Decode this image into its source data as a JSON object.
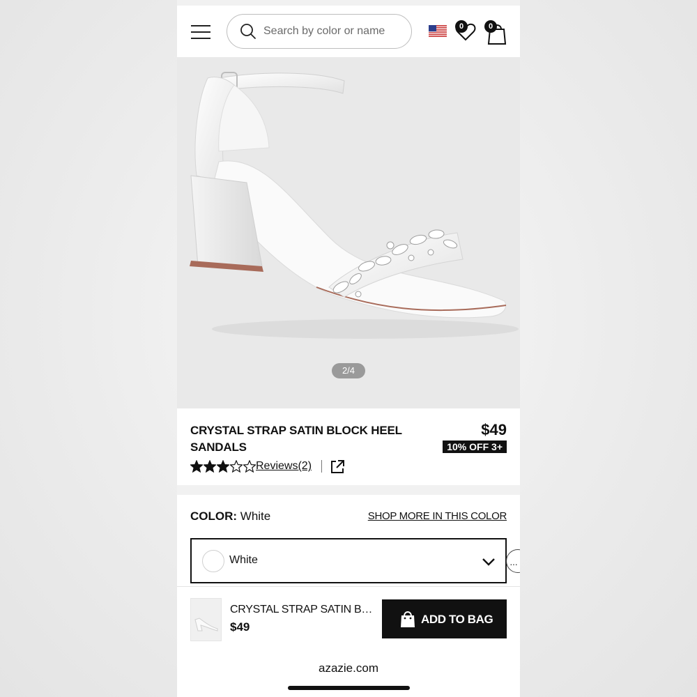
{
  "header": {
    "search_placeholder": "Search by color or name",
    "wishlist_count": "0",
    "bag_count": "0"
  },
  "gallery": {
    "counter": "2/4"
  },
  "product": {
    "title": "CRYSTAL STRAP SATIN BLOCK HEEL SANDALS",
    "price": "$49",
    "discount": "10% OFF 3+",
    "rating": 3,
    "rating_max": 5,
    "reviews_label": "Reviews(2)"
  },
  "color": {
    "label": "COLOR:",
    "value": "White",
    "shop_more": "SHOP MORE IN THIS COLOR",
    "selected": "White"
  },
  "sticky": {
    "name": "CRYSTAL STRAP SATIN BLOCK HEEL SANDALS",
    "price": "$49",
    "add_label": "ADD TO BAG"
  },
  "browser": {
    "url": "azazie.com"
  },
  "icons": [
    "menu-icon",
    "search-icon",
    "us-flag-icon",
    "heart-icon",
    "shopping-bag-icon",
    "star-icon",
    "share-icon",
    "chevron-down-icon",
    "chat-icon"
  ],
  "colors": {
    "primary": "#111111",
    "gallery_bg": "#e9e9e9",
    "counter_bg": "#9a9a9a"
  }
}
